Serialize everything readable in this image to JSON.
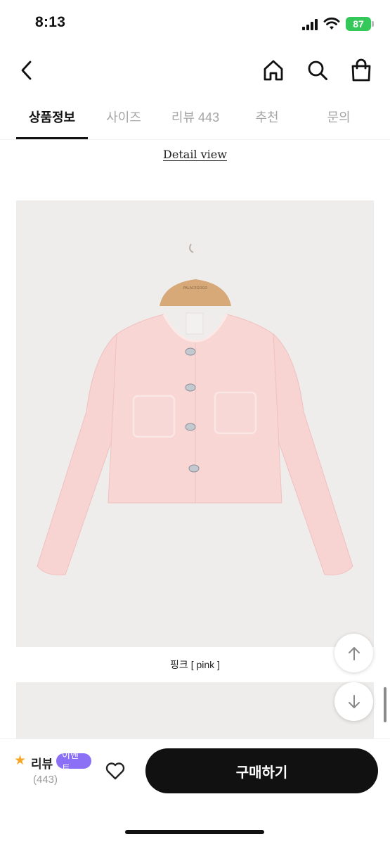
{
  "status_bar": {
    "time": "8:13",
    "battery": "87",
    "battery_color": "#34c759"
  },
  "nav": {
    "back_icon": "chevron-left-icon",
    "home_icon": "home-icon",
    "search_icon": "search-icon",
    "cart_icon": "shopping-bag-icon"
  },
  "tabs": [
    {
      "label": "상품정보",
      "active": true
    },
    {
      "label": "사이즈",
      "active": false
    },
    {
      "label": "리뷰 443",
      "active": false
    },
    {
      "label": "추천",
      "active": false
    },
    {
      "label": "문의",
      "active": false
    }
  ],
  "content": {
    "detail_link": "Detail view",
    "image_caption": "핑크 [ pink ]",
    "jacket_color": "#f8d6d4",
    "hanger_label": "PALACEGOGO"
  },
  "floating": {
    "up_icon": "arrow-up-icon",
    "down_icon": "arrow-down-icon"
  },
  "bottom_bar": {
    "review_label": "리뷰",
    "event_badge": "이벤트",
    "review_count": "(443)",
    "wishlist_icon": "heart-icon",
    "buy_label": "구매하기",
    "badge_color": "#8b6ff5",
    "star_color": "#f5a623"
  }
}
